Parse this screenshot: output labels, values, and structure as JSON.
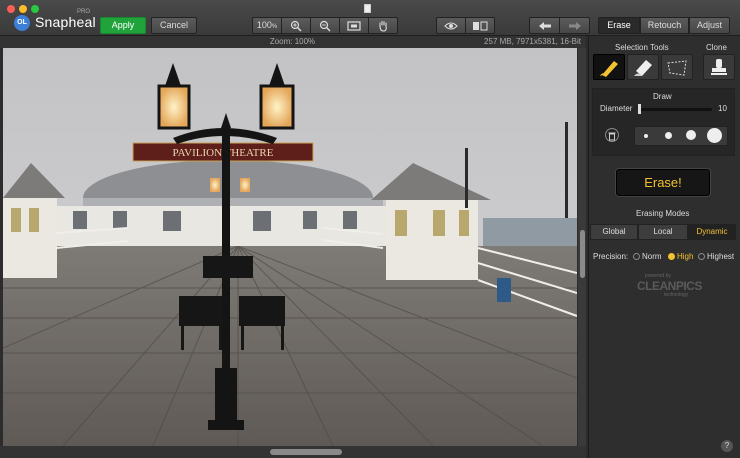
{
  "app": {
    "name": "Snapheal",
    "badge": "PRO",
    "logo": "OL"
  },
  "toolbar": {
    "apply": "Apply",
    "cancel": "Cancel",
    "zoom_value": "100",
    "zoom_unit": "%",
    "tabs": [
      "Erase",
      "Retouch",
      "Adjust"
    ],
    "active_tab": "Erase"
  },
  "info": {
    "zoom": "Zoom: 100%",
    "file": "257 MB, 7971x5381, 16-Bit"
  },
  "photo": {
    "sign": "PAVILION THEATRE"
  },
  "panel": {
    "selection_tools": "Selection Tools",
    "clone": "Clone",
    "draw": "Draw",
    "diameter_label": "Diameter",
    "diameter_value": "10",
    "erase_button": "Erase!",
    "erasing_modes": "Erasing Modes",
    "modes": [
      "Global",
      "Local",
      "Dynamic"
    ],
    "active_mode": "Dynamic",
    "precision_label": "Precision:",
    "precision": [
      "Norm",
      "High",
      "Highest"
    ],
    "active_precision": "High",
    "powered": "powered by",
    "brand": "CLEANPICS",
    "tech": "technology"
  },
  "help": "?",
  "colors": {
    "accent": "#f2c230",
    "apply": "#21a33c",
    "panel": "#2e2e2e"
  }
}
